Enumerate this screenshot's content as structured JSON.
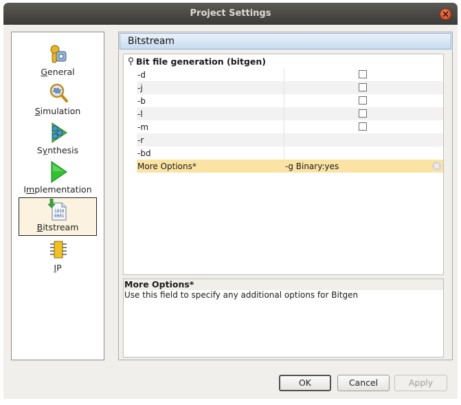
{
  "window": {
    "title": "Project Settings"
  },
  "nav": {
    "items": [
      {
        "label": "General",
        "mnemonic": "G",
        "rest": "eneral",
        "icon": "gears-icon"
      },
      {
        "label": "Simulation",
        "mnemonic": "S",
        "rest": "imulation",
        "icon": "magnifier-waveform-icon"
      },
      {
        "label": "Synthesis",
        "pre": "S",
        "mnemonic": "y",
        "rest": "nthesis",
        "icon": "synthesis-icon"
      },
      {
        "label": "Implementation",
        "pre": "I",
        "mnemonic": "m",
        "rest": "plementation",
        "icon": "play-arrow-icon"
      },
      {
        "label": "Bitstream",
        "mnemonic": "B",
        "rest": "itstream",
        "icon": "binary-file-icon",
        "selected": true
      },
      {
        "label": "IP",
        "mnemonic": "I",
        "rest": "P",
        "icon": "chip-icon"
      }
    ]
  },
  "panel": {
    "title": "Bitstream",
    "group": "Bit file generation (bitgen)",
    "rows": [
      {
        "key": "-d",
        "type": "checkbox",
        "checked": false
      },
      {
        "key": "-j",
        "type": "checkbox",
        "checked": false
      },
      {
        "key": "-b",
        "type": "checkbox",
        "checked": false
      },
      {
        "key": "-l",
        "type": "checkbox",
        "checked": false
      },
      {
        "key": "-m",
        "type": "checkbox",
        "checked": false
      },
      {
        "key": "-r",
        "type": "empty",
        "value": ""
      },
      {
        "key": "-bd",
        "type": "empty",
        "value": ""
      },
      {
        "key": "More Options*",
        "type": "text",
        "value": "-g Binary:yes",
        "selected": true
      }
    ],
    "description": {
      "title": "More Options*",
      "text": "Use this field to specify any additional options for Bitgen"
    }
  },
  "buttons": {
    "ok": "OK",
    "cancel": "Cancel",
    "apply": "Apply"
  },
  "colors": {
    "selected_row": "#fbe3a4",
    "header_bg": "#c9dcf0",
    "nav_selected": "#fbf2df"
  }
}
